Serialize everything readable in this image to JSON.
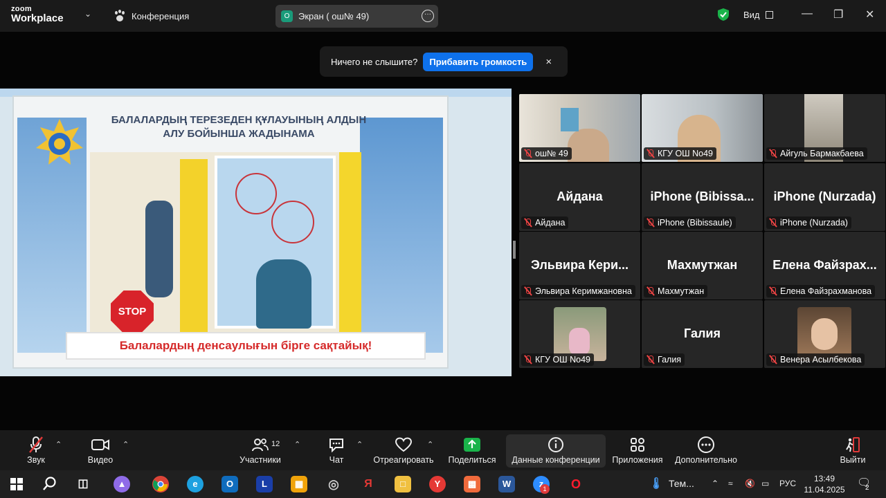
{
  "titlebar": {
    "logo_line1": "zoom",
    "logo_line2": "Workplace",
    "conference_label": "Конференция",
    "screen_icon_letter": "О",
    "screen_pill_label": "Экран ( ош№ 49)",
    "view_label": "Вид"
  },
  "toast": {
    "message": "Ничего не слышите?",
    "button": "Прибавить громкость",
    "close": "×"
  },
  "shared_content": {
    "title_line1": "БАЛАЛАРДЫҢ ТЕРЕЗЕДЕН ҚҰЛАУЫНЫҢ АЛДЫН",
    "title_line2": "АЛУ БОЙЫНША ЖАДЫНАМА",
    "stop_sign": "STOP",
    "bottom_slogan": "Балалардың денсаулығын бірге сақтайық!"
  },
  "gallery": {
    "tiles": [
      {
        "big": "",
        "label": "ош№ 49"
      },
      {
        "big": "",
        "label": "КГУ ОШ No49"
      },
      {
        "big": "",
        "label": "Айгуль Бармакбаева"
      },
      {
        "big": "Айдана",
        "label": "Айдана"
      },
      {
        "big": "iPhone (Bibissa...",
        "label": "iPhone (Bibissaule)"
      },
      {
        "big": "iPhone (Nurzada)",
        "label": "iPhone (Nurzada)"
      },
      {
        "big": "Эльвира Кери...",
        "label": "Эльвира Керимжановна"
      },
      {
        "big": "Махмутжан",
        "label": "Махмутжан"
      },
      {
        "big": "Елена Файзрах...",
        "label": "Елена Файзрахманова"
      },
      {
        "big": "",
        "label": "КГУ ОШ No49"
      },
      {
        "big": "Галия",
        "label": "Галия"
      },
      {
        "big": "",
        "label": "Венера Асылбекова"
      }
    ]
  },
  "toolbar": {
    "audio": "Звук",
    "video": "Видео",
    "participants": "Участники",
    "participants_count": "12",
    "chat": "Чат",
    "react": "Отреагировать",
    "share": "Поделиться",
    "info": "Данные конференции",
    "apps": "Приложения",
    "more": "Дополнительно",
    "leave": "Выйти"
  },
  "taskbar": {
    "weather": "Тем...",
    "lang": "РУС",
    "time": "13:49",
    "date": "11.04.2025",
    "notif_count": "2",
    "zoom_badge": "1"
  },
  "colors": {
    "accent_blue": "#0e71eb",
    "active_green": "#23d959",
    "share_green": "#1ab34a",
    "mute_red": "#ee4444"
  }
}
